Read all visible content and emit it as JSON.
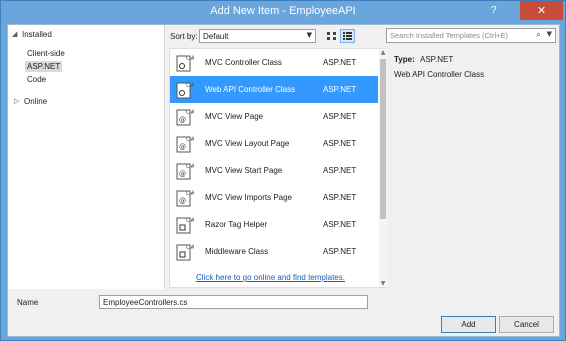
{
  "window": {
    "title": "Add New Item - EmployeeAPI",
    "help_label": "?",
    "close_label": "✕"
  },
  "tree": {
    "installed_label": "Installed",
    "children": [
      "Client-side",
      "ASP.NET",
      "Code"
    ],
    "selected": "ASP.NET",
    "online_label": "Online"
  },
  "toolbar": {
    "sort_label": "Sort by:",
    "sort_value": "Default",
    "search_placeholder": "Search Installed Templates (Ctrl+E)"
  },
  "templates": [
    {
      "name": "MVC Controller Class",
      "lang": "ASP.NET",
      "icon": "controller-class-icon"
    },
    {
      "name": "Web API Controller Class",
      "lang": "ASP.NET",
      "icon": "controller-class-icon",
      "selected": true
    },
    {
      "name": "MVC View Page",
      "lang": "ASP.NET",
      "icon": "view-page-icon"
    },
    {
      "name": "MVC View Layout Page",
      "lang": "ASP.NET",
      "icon": "view-page-icon"
    },
    {
      "name": "MVC View Start Page",
      "lang": "ASP.NET",
      "icon": "view-page-icon"
    },
    {
      "name": "MVC View Imports Page",
      "lang": "ASP.NET",
      "icon": "view-page-icon"
    },
    {
      "name": "Razor Tag Helper",
      "lang": "ASP.NET",
      "icon": "csharp-class-icon"
    },
    {
      "name": "Middleware Class",
      "lang": "ASP.NET",
      "icon": "csharp-class-icon"
    }
  ],
  "online_link": "Click here to go online and find templates.",
  "details": {
    "type_label": "Type:",
    "type_value": "ASP.NET",
    "description": "Web API Controller Class"
  },
  "name_field": {
    "label": "Name",
    "value": "EmployeeControllers.cs"
  },
  "buttons": {
    "add": "Add",
    "cancel": "Cancel"
  },
  "colors": {
    "title_bar": "#6aa6dc",
    "selection": "#3399ff",
    "link": "#1a5fb4"
  }
}
